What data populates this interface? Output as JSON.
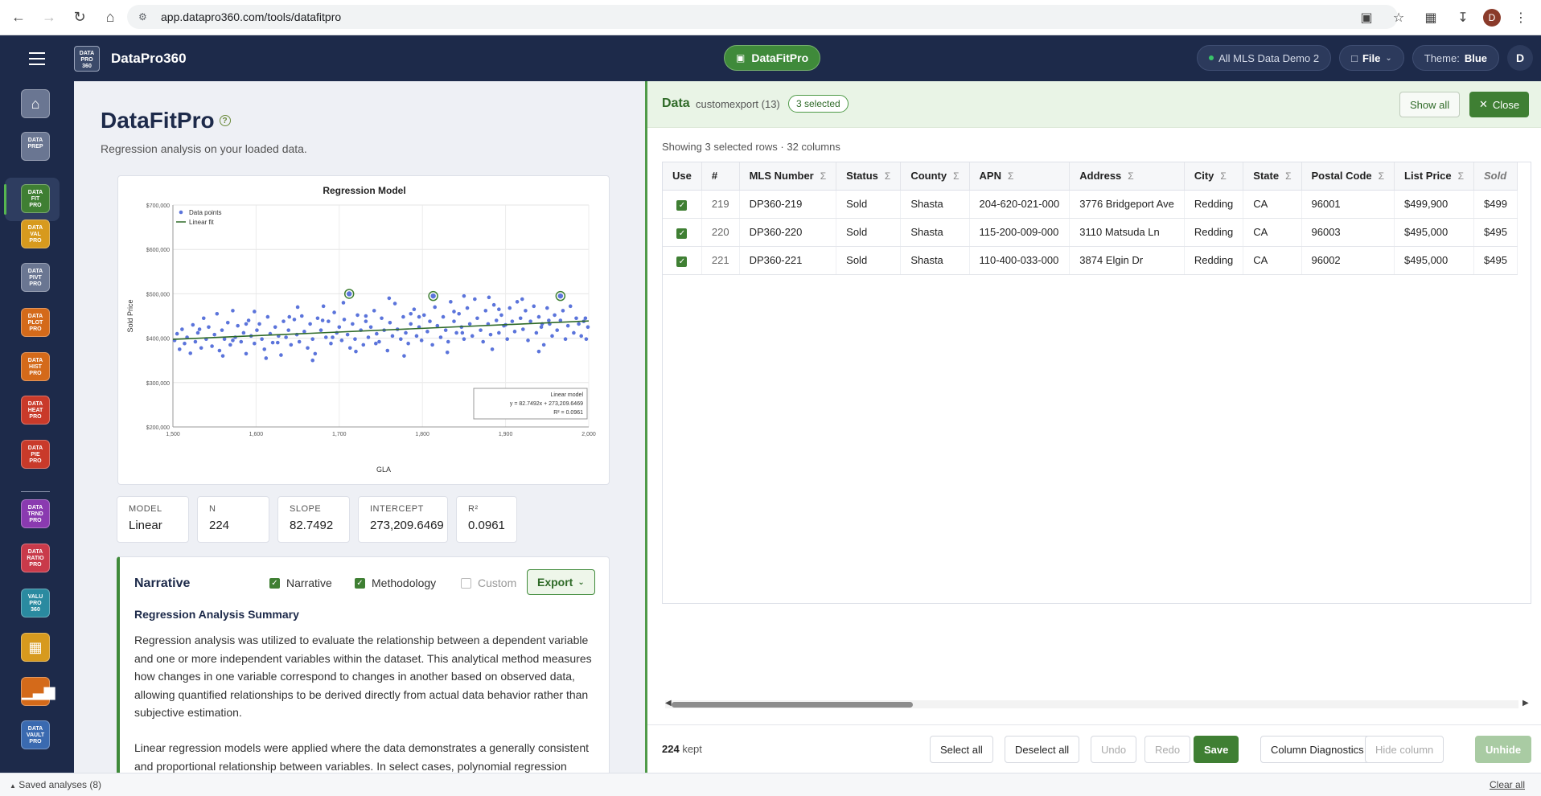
{
  "browser": {
    "url": "app.datapro360.com/tools/datafitpro",
    "avatar_letter": "D"
  },
  "header": {
    "brand": "DataPro360",
    "logo_lines": [
      "DATA",
      "PRO",
      "360"
    ],
    "center_tool": "DataFitPro",
    "dataset_chip": "All MLS Data Demo 2",
    "file_label": "File",
    "theme_label": "Theme:",
    "theme_value": "Blue",
    "user_letter": "D"
  },
  "sidebar": {
    "items": [
      {
        "name": "home",
        "lines": [],
        "color": "#6a7692"
      },
      {
        "name": "dataprep",
        "lines": [
          "DATA",
          "PREP"
        ],
        "color": "#6a7692"
      },
      {
        "name": "datafitpro",
        "lines": [
          "DATA",
          "FIT",
          "PRO"
        ],
        "color": "#3f7f33"
      },
      {
        "name": "datavalpro",
        "lines": [
          "DATA",
          "VAL",
          "PRO"
        ],
        "color": "#d79a1e"
      },
      {
        "name": "datapivtpro",
        "lines": [
          "DATA",
          "PIVT",
          "PRO"
        ],
        "color": "#6a7692"
      },
      {
        "name": "dataplotpro",
        "lines": [
          "DATA",
          "PLOT",
          "PRO"
        ],
        "color": "#d46a1a"
      },
      {
        "name": "datahistpro",
        "lines": [
          "DATA",
          "HIST",
          "PRO"
        ],
        "color": "#d46a1a"
      },
      {
        "name": "dataheatpro",
        "lines": [
          "DATA",
          "HEAT",
          "PRO"
        ],
        "color": "#c93a2a"
      },
      {
        "name": "datapiepro",
        "lines": [
          "DATA",
          "PIE",
          "PRO"
        ],
        "color": "#c93a2a"
      },
      {
        "name": "datatrndpro",
        "lines": [
          "DATA",
          "TRND",
          "PRO"
        ],
        "color": "#8a3ab0"
      },
      {
        "name": "dataratiopro",
        "lines": [
          "DATA",
          "RATIO",
          "PRO"
        ],
        "color": "#c93a4a"
      },
      {
        "name": "valupro360",
        "lines": [
          "VALU",
          "PRO",
          "360"
        ],
        "color": "#2a8aa0"
      },
      {
        "name": "grid-tool",
        "lines": [],
        "color": "#d79a1e"
      },
      {
        "name": "chart-tool",
        "lines": [],
        "color": "#d46a1a"
      },
      {
        "name": "datavaultpro",
        "lines": [
          "DATA",
          "VAULT",
          "PRO"
        ],
        "color": "#3a6ab0"
      }
    ]
  },
  "left": {
    "title": "DataFitPro",
    "subtitle": "Regression analysis on your loaded data.",
    "stats": [
      {
        "label": "MODEL",
        "value": "Linear"
      },
      {
        "label": "N",
        "value": "224"
      },
      {
        "label": "SLOPE",
        "value": "82.7492"
      },
      {
        "label": "INTERCEPT",
        "value": "273,209.6469"
      },
      {
        "label": "R²",
        "value": "0.0961"
      }
    ],
    "narrative": {
      "heading": "Narrative",
      "checks": [
        {
          "label": "Narrative",
          "checked": true
        },
        {
          "label": "Methodology",
          "checked": true
        },
        {
          "label": "Custom",
          "checked": false
        }
      ],
      "export_label": "Export",
      "summary_title": "Regression Analysis Summary",
      "p1": "Regression analysis was utilized to evaluate the relationship between a dependent variable and one or more independent variables within the dataset. This analytical method measures how changes in one variable correspond to changes in another based on observed data, allowing quantified relationships to be derived directly from actual data behavior rather than subjective estimation.",
      "p2": "Linear regression models were applied where the data demonstrates a generally consistent and proportional relationship between variables. In select cases, polynomial regression"
    }
  },
  "chart_data": {
    "type": "scatter",
    "title": "Regression Model",
    "xlabel": "GLA",
    "ylabel": "Sold Price",
    "xlim": [
      1500,
      2000
    ],
    "ylim": [
      200000,
      700000
    ],
    "x_ticks": [
      "1,500",
      "1,600",
      "1,700",
      "1,800",
      "1,900",
      "2,000"
    ],
    "y_ticks": [
      "$200,000",
      "$300,000",
      "$400,000",
      "$500,000",
      "$600,000",
      "$700,000"
    ],
    "legend": [
      "Data points",
      "Linear fit"
    ],
    "legend_position": "top-left",
    "grid": true,
    "fit": {
      "slope": 82.7492,
      "intercept": 273209.6469
    },
    "fit_box": {
      "title": "Linear model",
      "equation": "y = 82.7492x + 273,209.6469",
      "r2": "R² = 0.0961"
    },
    "highlighted": [
      {
        "x": 1712,
        "y": 499900
      },
      {
        "x": 1813,
        "y": 495000
      },
      {
        "x": 1966,
        "y": 495000
      }
    ],
    "points": [
      [
        1502,
        395000
      ],
      [
        1505,
        410000
      ],
      [
        1508,
        375000
      ],
      [
        1511,
        420000
      ],
      [
        1514,
        388000
      ],
      [
        1517,
        402000
      ],
      [
        1521,
        366000
      ],
      [
        1524,
        430000
      ],
      [
        1527,
        392000
      ],
      [
        1530,
        412000
      ],
      [
        1534,
        378000
      ],
      [
        1537,
        445000
      ],
      [
        1540,
        398000
      ],
      [
        1543,
        425000
      ],
      [
        1547,
        382000
      ],
      [
        1550,
        408000
      ],
      [
        1553,
        455000
      ],
      [
        1556,
        372000
      ],
      [
        1559,
        418000
      ],
      [
        1562,
        398000
      ],
      [
        1566,
        435000
      ],
      [
        1569,
        385000
      ],
      [
        1572,
        462000
      ],
      [
        1575,
        402000
      ],
      [
        1578,
        428000
      ],
      [
        1582,
        392000
      ],
      [
        1585,
        412000
      ],
      [
        1588,
        365000
      ],
      [
        1591,
        440000
      ],
      [
        1594,
        405000
      ],
      [
        1598,
        388000
      ],
      [
        1601,
        418000
      ],
      [
        1604,
        432000
      ],
      [
        1607,
        398000
      ],
      [
        1610,
        375000
      ],
      [
        1614,
        448000
      ],
      [
        1617,
        410000
      ],
      [
        1620,
        390000
      ],
      [
        1623,
        425000
      ],
      [
        1627,
        405000
      ],
      [
        1630,
        362000
      ],
      [
        1633,
        438000
      ],
      [
        1636,
        402000
      ],
      [
        1639,
        418000
      ],
      [
        1642,
        385000
      ],
      [
        1646,
        442000
      ],
      [
        1649,
        408000
      ],
      [
        1652,
        392000
      ],
      [
        1655,
        450000
      ],
      [
        1658,
        415000
      ],
      [
        1662,
        378000
      ],
      [
        1665,
        432000
      ],
      [
        1668,
        398000
      ],
      [
        1671,
        365000
      ],
      [
        1674,
        445000
      ],
      [
        1678,
        418000
      ],
      [
        1681,
        472000
      ],
      [
        1684,
        402000
      ],
      [
        1687,
        438000
      ],
      [
        1690,
        388000
      ],
      [
        1694,
        458000
      ],
      [
        1697,
        412000
      ],
      [
        1700,
        425000
      ],
      [
        1703,
        395000
      ],
      [
        1706,
        442000
      ],
      [
        1710,
        408000
      ],
      [
        1713,
        378000
      ],
      [
        1716,
        432000
      ],
      [
        1719,
        398000
      ],
      [
        1722,
        452000
      ],
      [
        1726,
        418000
      ],
      [
        1729,
        385000
      ],
      [
        1732,
        438000
      ],
      [
        1735,
        402000
      ],
      [
        1738,
        425000
      ],
      [
        1742,
        462000
      ],
      [
        1745,
        410000
      ],
      [
        1748,
        392000
      ],
      [
        1751,
        445000
      ],
      [
        1754,
        418000
      ],
      [
        1758,
        372000
      ],
      [
        1761,
        435000
      ],
      [
        1764,
        405000
      ],
      [
        1767,
        478000
      ],
      [
        1770,
        420000
      ],
      [
        1774,
        398000
      ],
      [
        1777,
        448000
      ],
      [
        1780,
        412000
      ],
      [
        1783,
        388000
      ],
      [
        1786,
        432000
      ],
      [
        1790,
        465000
      ],
      [
        1793,
        405000
      ],
      [
        1796,
        425000
      ],
      [
        1799,
        395000
      ],
      [
        1802,
        452000
      ],
      [
        1806,
        415000
      ],
      [
        1809,
        438000
      ],
      [
        1812,
        385000
      ],
      [
        1815,
        470000
      ],
      [
        1818,
        428000
      ],
      [
        1822,
        402000
      ],
      [
        1825,
        448000
      ],
      [
        1828,
        418000
      ],
      [
        1831,
        392000
      ],
      [
        1834,
        482000
      ],
      [
        1838,
        438000
      ],
      [
        1841,
        412000
      ],
      [
        1844,
        455000
      ],
      [
        1847,
        425000
      ],
      [
        1850,
        398000
      ],
      [
        1854,
        468000
      ],
      [
        1857,
        432000
      ],
      [
        1860,
        405000
      ],
      [
        1863,
        488000
      ],
      [
        1866,
        445000
      ],
      [
        1870,
        418000
      ],
      [
        1873,
        392000
      ],
      [
        1876,
        462000
      ],
      [
        1879,
        432000
      ],
      [
        1882,
        408000
      ],
      [
        1886,
        475000
      ],
      [
        1889,
        440000
      ],
      [
        1892,
        412000
      ],
      [
        1895,
        452000
      ],
      [
        1898,
        428000
      ],
      [
        1902,
        398000
      ],
      [
        1905,
        468000
      ],
      [
        1908,
        438000
      ],
      [
        1911,
        415000
      ],
      [
        1914,
        482000
      ],
      [
        1918,
        445000
      ],
      [
        1921,
        420000
      ],
      [
        1924,
        462000
      ],
      [
        1927,
        395000
      ],
      [
        1930,
        438000
      ],
      [
        1934,
        472000
      ],
      [
        1937,
        412000
      ],
      [
        1940,
        448000
      ],
      [
        1943,
        425000
      ],
      [
        1946,
        385000
      ],
      [
        1950,
        468000
      ],
      [
        1953,
        432000
      ],
      [
        1956,
        405000
      ],
      [
        1959,
        452000
      ],
      [
        1962,
        418000
      ],
      [
        1966,
        440000
      ],
      [
        1969,
        462000
      ],
      [
        1972,
        398000
      ],
      [
        1975,
        428000
      ],
      [
        1978,
        472000
      ],
      [
        1982,
        412000
      ],
      [
        1985,
        445000
      ],
      [
        1988,
        432000
      ],
      [
        1991,
        405000
      ],
      [
        1994,
        438000
      ],
      [
        1997,
        398000
      ],
      [
        1999,
        425000
      ],
      [
        1560,
        360000
      ],
      [
        1612,
        355000
      ],
      [
        1668,
        350000
      ],
      [
        1720,
        370000
      ],
      [
        1778,
        360000
      ],
      [
        1830,
        368000
      ],
      [
        1884,
        375000
      ],
      [
        1940,
        370000
      ],
      [
        1598,
        460000
      ],
      [
        1650,
        470000
      ],
      [
        1705,
        480000
      ],
      [
        1760,
        490000
      ],
      [
        1850,
        495000
      ],
      [
        1880,
        492000
      ],
      [
        1920,
        488000
      ],
      [
        1532,
        420000
      ],
      [
        1588,
        432000
      ],
      [
        1640,
        448000
      ],
      [
        1692,
        402000
      ],
      [
        1744,
        388000
      ],
      [
        1796,
        448000
      ],
      [
        1848,
        412000
      ],
      [
        1900,
        430000
      ],
      [
        1952,
        440000
      ],
      [
        1572,
        395000
      ],
      [
        1626,
        390000
      ],
      [
        1680,
        440000
      ],
      [
        1732,
        450000
      ],
      [
        1786,
        455000
      ],
      [
        1838,
        460000
      ],
      [
        1892,
        465000
      ],
      [
        1944,
        432000
      ],
      [
        1996,
        445000
      ]
    ]
  },
  "right": {
    "title": "Data",
    "file": "customexport (13)",
    "selected_badge": "3 selected",
    "show_all": "Show all",
    "close": "Close",
    "showing": "Showing 3 selected rows · 32 columns",
    "columns": [
      "Use",
      "#",
      "MLS Number",
      "Status",
      "County",
      "APN",
      "Address",
      "City",
      "State",
      "Postal Code",
      "List Price",
      "Sold"
    ],
    "sigma_cols": [
      2,
      3,
      4,
      5,
      6,
      7,
      8,
      9,
      10
    ],
    "rows": [
      {
        "num": "219",
        "mls": "DP360-219",
        "status": "Sold",
        "county": "Shasta",
        "apn": "204-620-021-000",
        "address": "3776 Bridgeport Ave",
        "city": "Redding",
        "state": "CA",
        "postal": "96001",
        "list": "$499,900",
        "sold": "$499"
      },
      {
        "num": "220",
        "mls": "DP360-220",
        "status": "Sold",
        "county": "Shasta",
        "apn": "115-200-009-000",
        "address": "3110 Matsuda Ln",
        "city": "Redding",
        "state": "CA",
        "postal": "96003",
        "list": "$495,000",
        "sold": "$495"
      },
      {
        "num": "221",
        "mls": "DP360-221",
        "status": "Sold",
        "county": "Shasta",
        "apn": "110-400-033-000",
        "address": "3874 Elgin Dr",
        "city": "Redding",
        "state": "CA",
        "postal": "96002",
        "list": "$495,000",
        "sold": "$495"
      }
    ],
    "footer": {
      "kept_count": "224",
      "kept_label": "kept",
      "select_all": "Select all",
      "deselect_all": "Deselect all",
      "undo": "Undo",
      "redo": "Redo",
      "save": "Save",
      "column_diagnostics": "Column Diagnostics",
      "hide_column": "Hide column",
      "unhide": "Unhide"
    }
  },
  "status": {
    "saved": "Saved analyses (8)",
    "clear_all": "Clear all"
  },
  "colors": {
    "navy": "#1d2a4a",
    "green": "#3f7f33",
    "point": "#5b74db",
    "fit_line": "#2f6a28"
  }
}
